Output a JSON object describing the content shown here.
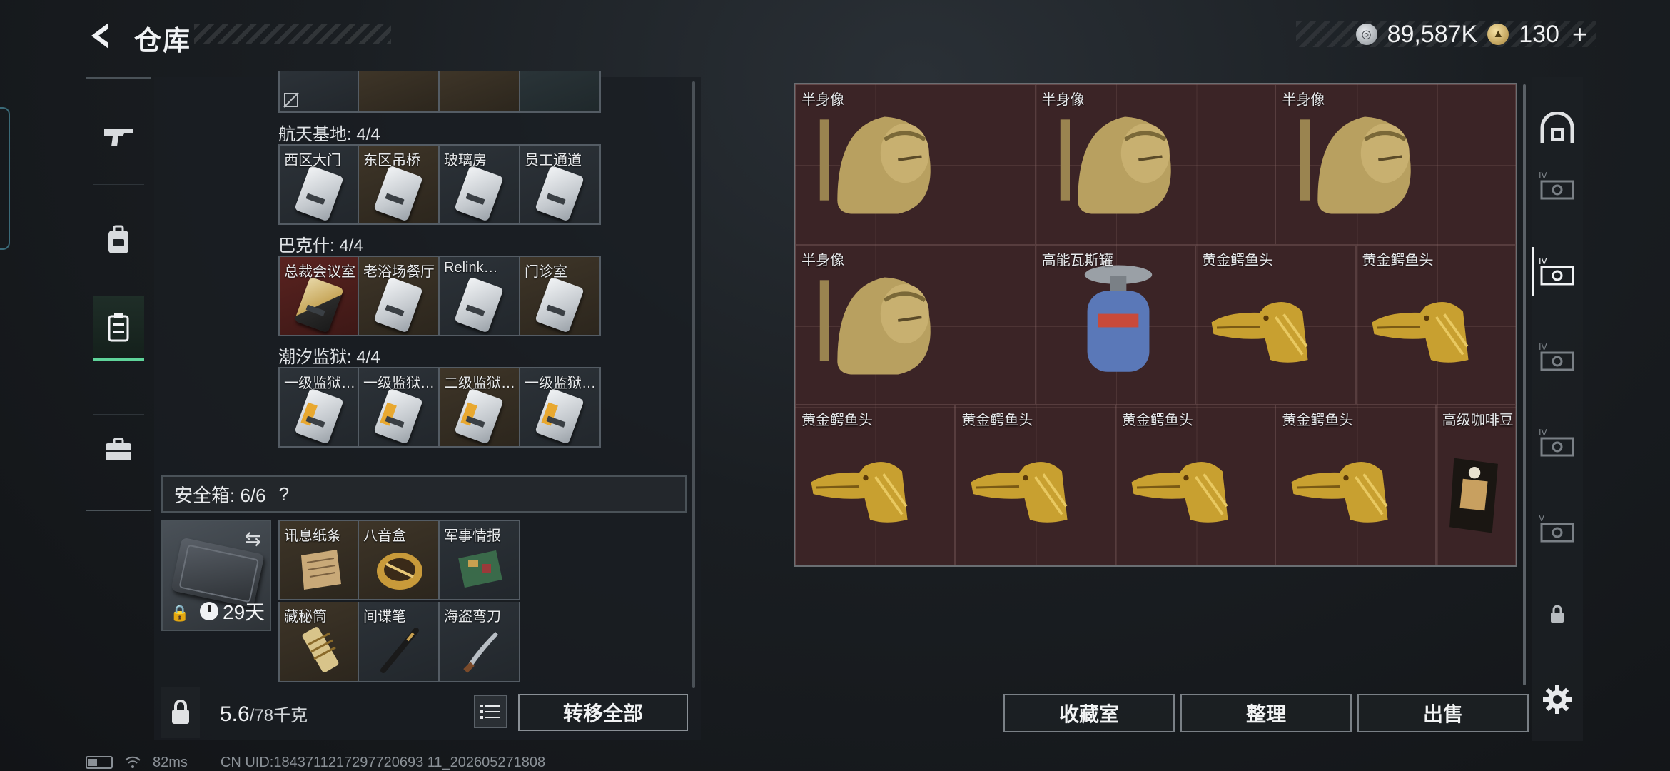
{
  "header": {
    "title": "仓库",
    "currency_silver": "89,587K",
    "currency_gold": "130",
    "plus": "+"
  },
  "left_nav": [
    {
      "icon": "rifle-icon"
    },
    {
      "icon": "backpack-icon"
    },
    {
      "icon": "storage-icon",
      "active": true
    },
    {
      "icon": "briefcase-icon"
    }
  ],
  "storage": {
    "sections": [
      {
        "title": "航天基地: 4/4",
        "items": [
          {
            "name": "西区大门",
            "color": "gray"
          },
          {
            "name": "东区吊桥",
            "color": "brown"
          },
          {
            "name": "玻璃房",
            "color": "gray"
          },
          {
            "name": "员工通道",
            "color": "gray"
          }
        ]
      },
      {
        "title": "巴克什: 4/4",
        "items": [
          {
            "name": "总裁会议室",
            "color": "red"
          },
          {
            "name": "老浴场餐厅",
            "color": "brown"
          },
          {
            "name": "Relink…",
            "color": "gray"
          },
          {
            "name": "门诊室",
            "color": "brown"
          }
        ]
      },
      {
        "title": "潮汐监狱: 4/4",
        "items": [
          {
            "name": "一级监狱…",
            "color": "gray"
          },
          {
            "name": "一级监狱…",
            "color": "gray"
          },
          {
            "name": "二级监狱…",
            "color": "brown"
          },
          {
            "name": "一级监狱…",
            "color": "gray"
          }
        ]
      }
    ]
  },
  "safe_box": {
    "label": "安全箱: 6/6",
    "help": "?",
    "timer": "29天",
    "items": [
      {
        "name": "讯息纸条"
      },
      {
        "name": "八音盒"
      },
      {
        "name": "军事情报"
      },
      {
        "name": "藏秘筒"
      },
      {
        "name": "间谍笔"
      },
      {
        "name": "海盗弯刀"
      }
    ]
  },
  "bottom_left": {
    "weight_current": "5.6",
    "weight_max": "/78千克",
    "transfer_all": "转移全部"
  },
  "collection": {
    "items": [
      {
        "name": "半身像",
        "kind": "bust"
      },
      {
        "name": "半身像",
        "kind": "bust"
      },
      {
        "name": "半身像",
        "kind": "bust"
      },
      {
        "name": "半身像",
        "kind": "bust"
      },
      {
        "name": "高能瓦斯罐",
        "kind": "gas"
      },
      {
        "name": "黄金鳄鱼头",
        "kind": "croc"
      },
      {
        "name": "黄金鳄鱼头",
        "kind": "croc"
      },
      {
        "name": "黄金鳄鱼头",
        "kind": "croc"
      },
      {
        "name": "黄金鳄鱼头",
        "kind": "croc"
      },
      {
        "name": "黄金鳄鱼头",
        "kind": "croc"
      },
      {
        "name": "黄金鳄鱼头",
        "kind": "croc"
      },
      {
        "name": "高级咖啡豆",
        "kind": "coffee"
      }
    ]
  },
  "right_tabs": [
    {
      "icon": "vault-icon"
    },
    {
      "icon": "container-tier-iv-icon"
    },
    {
      "icon": "container-tier-iv-icon",
      "active": true
    },
    {
      "icon": "container-tier-iv-icon"
    },
    {
      "icon": "container-tier-iv-icon"
    },
    {
      "icon": "container-tier-v-icon"
    },
    {
      "icon": "lock-icon"
    }
  ],
  "bottom_right": {
    "collection_room": "收藏室",
    "organize": "整理",
    "sell": "出售"
  },
  "status": {
    "ping": "82ms",
    "uid": "CN UID:1843711217297720693 11_202605271808"
  },
  "colors": {
    "active_green": "#5fd49a",
    "collection_bg": "#3b2426"
  }
}
